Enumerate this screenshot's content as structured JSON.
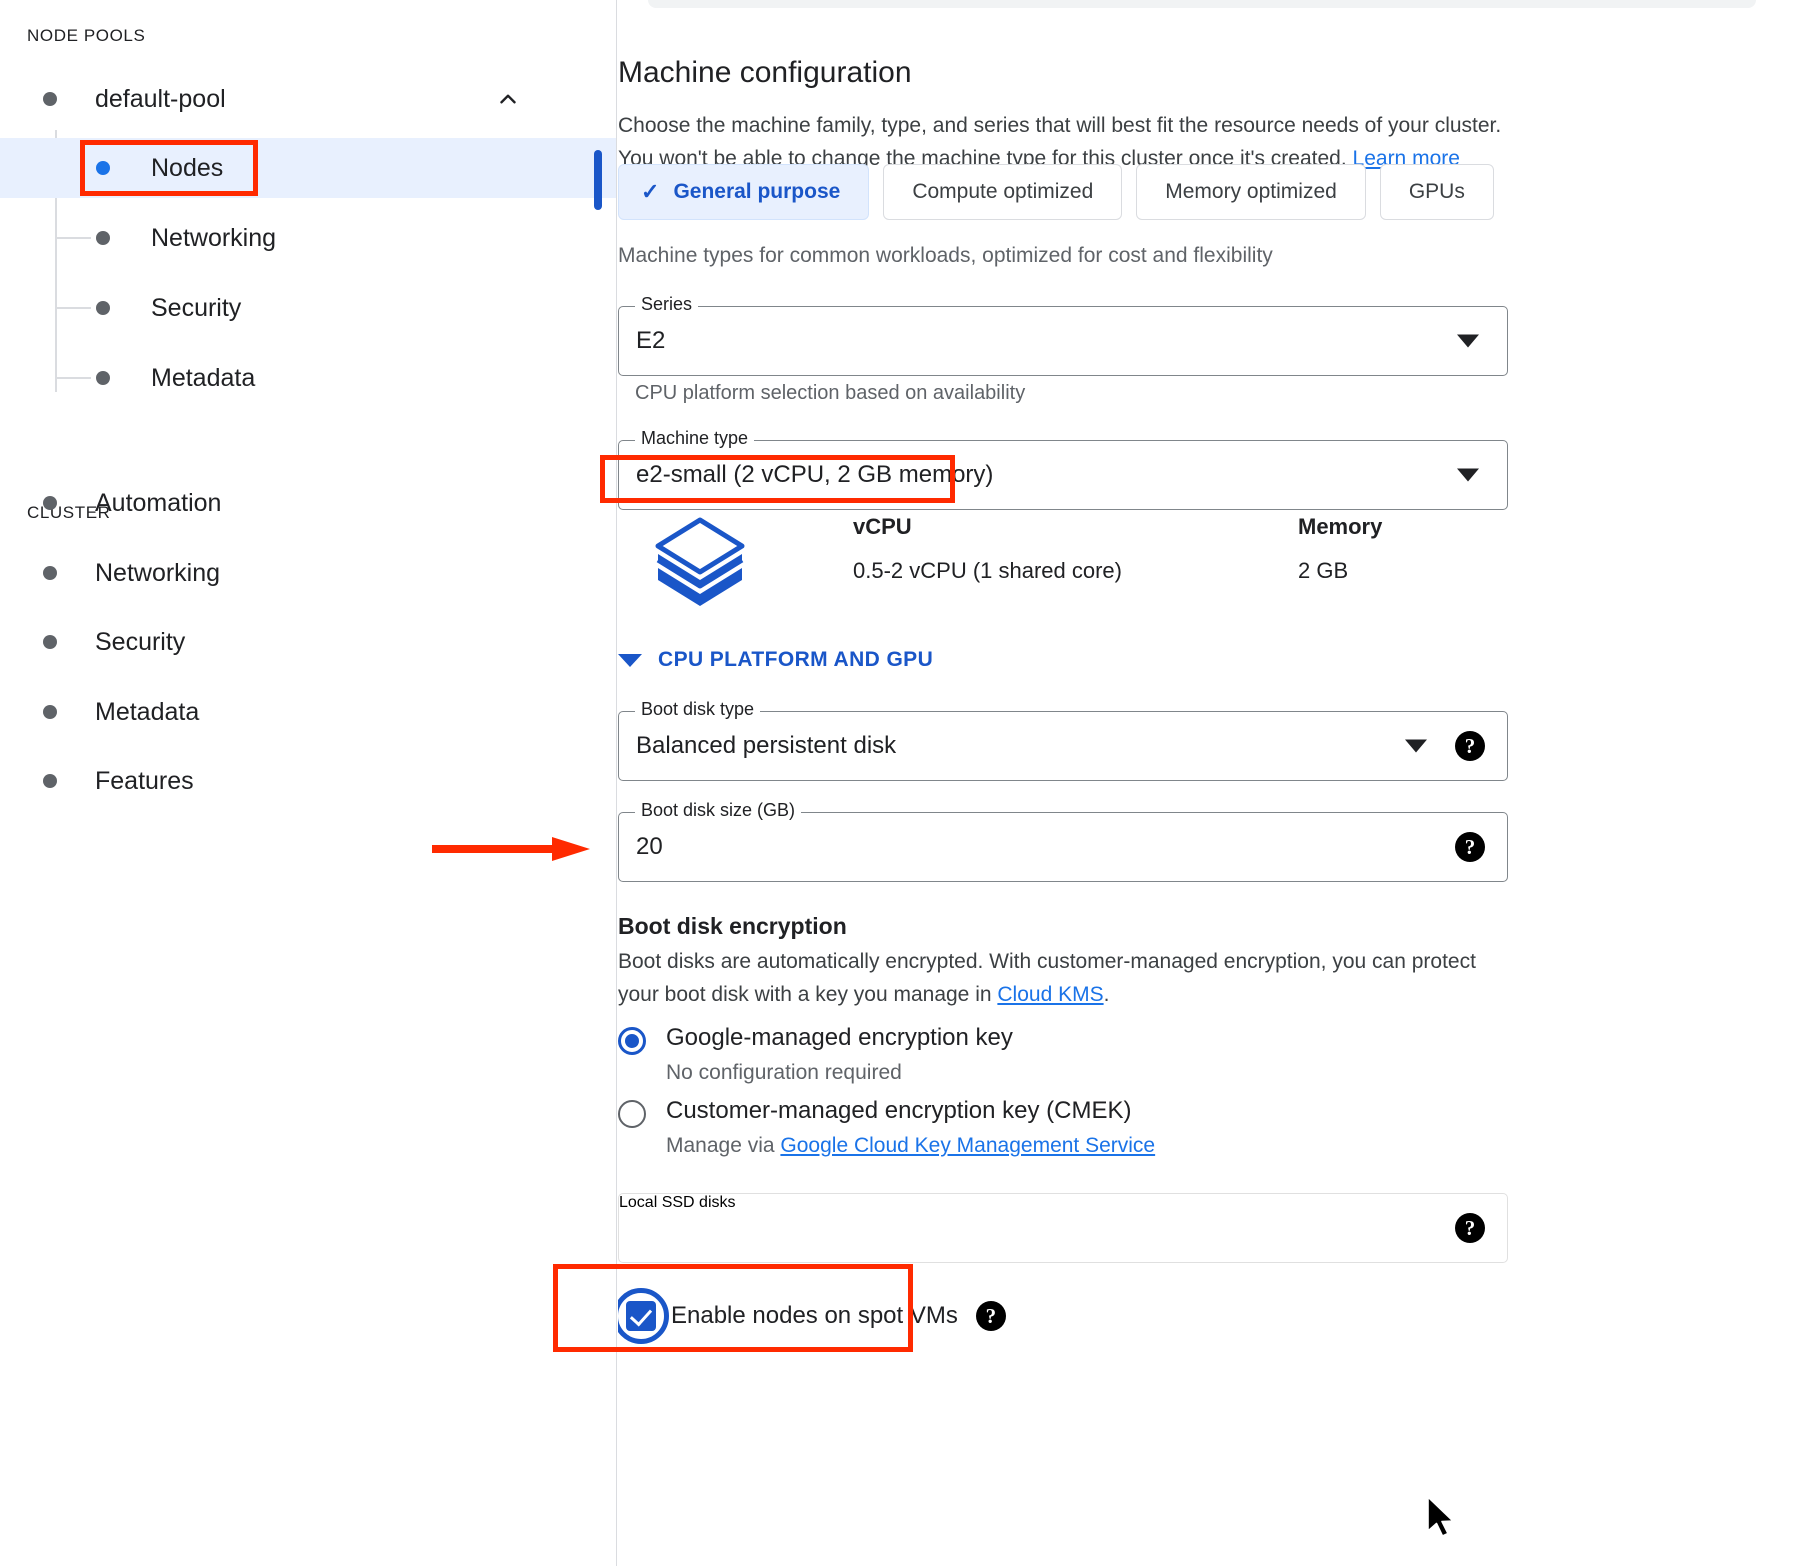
{
  "sidebar": {
    "node_pools_title": "NODE POOLS",
    "cluster_title": "CLUSTER",
    "pool": {
      "label": "default-pool",
      "collapse_icon": "chevron-up-icon"
    },
    "pool_children": [
      {
        "label": "Nodes",
        "selected": true
      },
      {
        "label": "Networking",
        "selected": false
      },
      {
        "label": "Security",
        "selected": false
      },
      {
        "label": "Metadata",
        "selected": false
      }
    ],
    "cluster_items": [
      {
        "label": "Automation"
      },
      {
        "label": "Networking"
      },
      {
        "label": "Security"
      },
      {
        "label": "Metadata"
      },
      {
        "label": "Features"
      }
    ]
  },
  "main": {
    "title": "Machine configuration",
    "description_part1": "Choose the machine family, type, and series that will best fit the resource needs of your cluster. You won't be able to change the machine type for this cluster once it's created. ",
    "learn_more": "Learn more",
    "families": [
      {
        "label": "General purpose",
        "active": true,
        "check_icon": "check-icon"
      },
      {
        "label": "Compute optimized",
        "active": false
      },
      {
        "label": "Memory optimized",
        "active": false
      },
      {
        "label": "GPUs",
        "active": false
      }
    ],
    "family_note": "Machine types for common workloads, optimized for cost and flexibility",
    "series": {
      "legend": "Series",
      "value": "E2",
      "hint": "CPU platform selection based on availability",
      "dropdown_icon": "chevron-down-icon"
    },
    "machine_type": {
      "legend": "Machine type",
      "value": "e2-small (2 vCPU, 2 GB memory)",
      "dropdown_icon": "chevron-down-icon"
    },
    "specs": {
      "icon": "layers-stack-icon",
      "vcpu_header": "vCPU",
      "vcpu_value": "0.5-2 vCPU (1 shared core)",
      "memory_header": "Memory",
      "memory_value": "2 GB"
    },
    "cpu_platform_toggle": {
      "label": "CPU PLATFORM AND GPU",
      "icon": "chevron-down-icon"
    },
    "boot_disk_type": {
      "legend": "Boot disk type",
      "value": "Balanced persistent disk",
      "dropdown_icon": "chevron-down-icon",
      "help_icon": "help-icon"
    },
    "boot_disk_size": {
      "legend": "Boot disk size (GB)",
      "value": "20",
      "help_icon": "help-icon"
    },
    "boot_disk_encryption": {
      "title": "Boot disk encryption",
      "description_part1": "Boot disks are automatically encrypted. With customer-managed encryption, you can protect your boot disk with a key you manage in ",
      "description_link": "Cloud KMS",
      "description_part2": ".",
      "options": [
        {
          "label": "Google-managed encryption key",
          "sub": "No configuration required",
          "checked": true
        },
        {
          "label": "Customer-managed encryption key (CMEK)",
          "sub_prefix": "Manage via ",
          "sub_link": "Google Cloud Key Management Service",
          "checked": false
        }
      ]
    },
    "local_ssd": {
      "placeholder": "Local SSD disks",
      "help_icon": "help-icon"
    },
    "spot_vms": {
      "label": "Enable nodes on spot VMs",
      "checked": true,
      "help_icon": "help-icon"
    }
  },
  "annotations": {
    "highlight_nodes": "red-rect-around-nodes",
    "highlight_machine_type": "red-rect-around-machine-type",
    "highlight_spot_vms": "red-rect-around-spot-vms",
    "arrow_to_boot_disk_size": "red-arrow-pointing-right",
    "cursor": "mouse-pointer"
  },
  "colors": {
    "accent_blue": "#1a73e8",
    "selected_blue": "#1a56c8",
    "selected_bg": "#e8f0fe",
    "annotation_red": "#ff2a00",
    "text_primary": "#202124",
    "text_secondary": "#5f6368"
  }
}
